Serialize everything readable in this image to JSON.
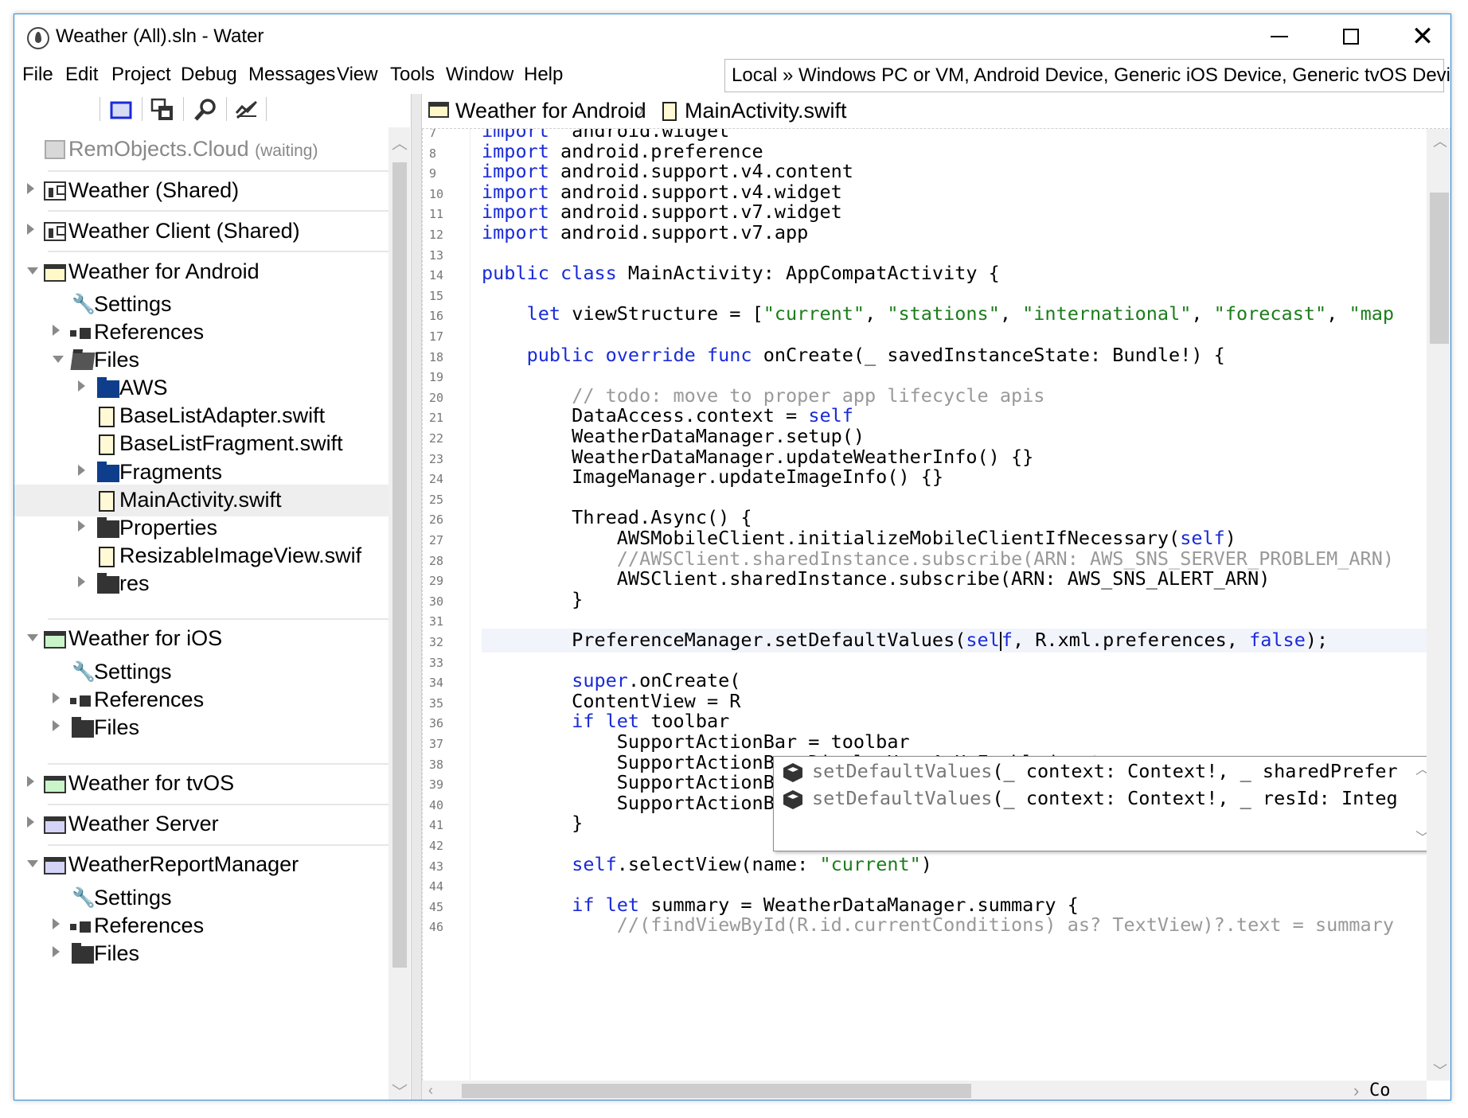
{
  "window": {
    "title": "Weather (All).sln - Water"
  },
  "menu": [
    "File",
    "Edit",
    "Project",
    "Debug",
    "Messages",
    "View",
    "Tools",
    "Window",
    "Help"
  ],
  "target": "Local » Windows PC or VM, Android Device, Generic iOS Device, Generic tvOS Device",
  "toolbar": {
    "icons": [
      "solution-view-icon",
      "split-view-icon",
      "find-icon",
      "compare-icon"
    ]
  },
  "sidebar": {
    "cloud": {
      "label": "RemObjects.Cloud",
      "status": "(waiting)"
    },
    "items": [
      {
        "label": "Weather (Shared)"
      },
      {
        "label": "Weather Client (Shared)"
      },
      {
        "label": "Weather for Android"
      },
      {
        "label": "Settings"
      },
      {
        "label": "References"
      },
      {
        "label": "Files"
      },
      {
        "label": "AWS"
      },
      {
        "label": "BaseListAdapter.swift"
      },
      {
        "label": "BaseListFragment.swift"
      },
      {
        "label": "Fragments"
      },
      {
        "label": "MainActivity.swift"
      },
      {
        "label": "Properties"
      },
      {
        "label": "ResizableImageView.swif"
      },
      {
        "label": "res"
      },
      {
        "label": "Weather for iOS"
      },
      {
        "label": "Settings"
      },
      {
        "label": "References"
      },
      {
        "label": "Files"
      },
      {
        "label": "Weather for tvOS"
      },
      {
        "label": "Weather Server"
      },
      {
        "label": "WeatherReportManager"
      },
      {
        "label": "Settings"
      },
      {
        "label": "References"
      },
      {
        "label": "Files"
      }
    ]
  },
  "breadcrumb": {
    "project": "Weather for Android",
    "file": "MainActivity.swift"
  },
  "editor": {
    "lines": [
      {
        "n": "7",
        "parts": [
          [
            "kw",
            "import"
          ],
          [
            "",
            "  android.widget"
          ]
        ]
      },
      {
        "n": "8",
        "parts": [
          [
            "kw",
            "import"
          ],
          [
            "",
            " android.preference"
          ]
        ]
      },
      {
        "n": "9",
        "parts": [
          [
            "kw",
            "import"
          ],
          [
            "",
            " android.support.v4.content"
          ]
        ]
      },
      {
        "n": "10",
        "parts": [
          [
            "kw",
            "import"
          ],
          [
            "",
            " android.support.v4.widget"
          ]
        ]
      },
      {
        "n": "11",
        "parts": [
          [
            "kw",
            "import"
          ],
          [
            "",
            " android.support.v7.widget"
          ]
        ]
      },
      {
        "n": "12",
        "parts": [
          [
            "kw",
            "import"
          ],
          [
            "",
            " android.support.v7.app"
          ]
        ]
      },
      {
        "n": "13",
        "parts": []
      },
      {
        "n": "14",
        "parts": [
          [
            "kw",
            "public class"
          ],
          [
            "",
            " MainActivity: AppCompatActivity {"
          ]
        ]
      },
      {
        "n": "15",
        "parts": []
      },
      {
        "n": "16",
        "parts": [
          [
            "",
            "    "
          ],
          [
            "kw",
            "let"
          ],
          [
            "",
            " viewStructure = ["
          ],
          [
            "str",
            "\"current\""
          ],
          [
            "",
            ", "
          ],
          [
            "str",
            "\"stations\""
          ],
          [
            "",
            ", "
          ],
          [
            "str",
            "\"international\""
          ],
          [
            "",
            ", "
          ],
          [
            "str",
            "\"forecast\""
          ],
          [
            "",
            ", "
          ],
          [
            "str",
            "\"map"
          ]
        ]
      },
      {
        "n": "17",
        "parts": []
      },
      {
        "n": "18",
        "parts": [
          [
            "",
            "    "
          ],
          [
            "kw",
            "public override func"
          ],
          [
            "",
            " onCreate(_ savedInstanceState: Bundle!) {"
          ]
        ]
      },
      {
        "n": "19",
        "parts": []
      },
      {
        "n": "20",
        "parts": [
          [
            "",
            "        "
          ],
          [
            "cmt",
            "// todo: move to proper app lifecycle apis"
          ]
        ]
      },
      {
        "n": "21",
        "parts": [
          [
            "",
            "        DataAccess.context = "
          ],
          [
            "kw",
            "self"
          ]
        ]
      },
      {
        "n": "22",
        "parts": [
          [
            "",
            "        WeatherDataManager.setup()"
          ]
        ]
      },
      {
        "n": "23",
        "parts": [
          [
            "",
            "        WeatherDataManager.updateWeatherInfo() {}"
          ]
        ]
      },
      {
        "n": "24",
        "parts": [
          [
            "",
            "        ImageManager.updateImageInfo() {}"
          ]
        ]
      },
      {
        "n": "25",
        "parts": []
      },
      {
        "n": "26",
        "parts": [
          [
            "",
            "        Thread.Async() {"
          ]
        ]
      },
      {
        "n": "27",
        "parts": [
          [
            "",
            "            AWSMobileClient.initializeMobileClientIfNecessary("
          ],
          [
            "kw",
            "self"
          ],
          [
            "",
            ")"
          ]
        ]
      },
      {
        "n": "28",
        "parts": [
          [
            "",
            "            "
          ],
          [
            "cmt",
            "//AWSClient.sharedInstance.subscribe(ARN: AWS_SNS_SERVER_PROBLEM_ARN)"
          ]
        ]
      },
      {
        "n": "29",
        "parts": [
          [
            "",
            "            AWSClient.sharedInstance.subscribe(ARN: AWS_SNS_ALERT_ARN)"
          ]
        ]
      },
      {
        "n": "30",
        "parts": [
          [
            "",
            "        }"
          ]
        ]
      },
      {
        "n": "31",
        "parts": []
      },
      {
        "n": "32",
        "parts": [
          [
            "",
            "        PreferenceManager.setDefaultValues("
          ],
          [
            "kw",
            "sel"
          ],
          [
            "caret",
            ""
          ],
          [
            "kw",
            "f"
          ],
          [
            "",
            ", R.xml.preferences, "
          ],
          [
            "kw",
            "false"
          ],
          [
            "",
            ");"
          ]
        ]
      },
      {
        "n": "33",
        "parts": []
      },
      {
        "n": "34",
        "parts": [
          [
            "",
            "        "
          ],
          [
            "kw",
            "super"
          ],
          [
            "",
            ".onCreate("
          ]
        ]
      },
      {
        "n": "35",
        "parts": [
          [
            "",
            "        ContentView = R"
          ]
        ]
      },
      {
        "n": "36",
        "parts": [
          [
            "",
            "        "
          ],
          [
            "kw",
            "if let"
          ],
          [
            "",
            " toolbar"
          ]
        ]
      },
      {
        "n": "37",
        "parts": [
          [
            "",
            "            SupportActionBar = toolbar"
          ]
        ]
      },
      {
        "n": "38",
        "parts": [
          [
            "",
            "            SupportActionBar.DisplayHomeAsUpEnabled = "
          ],
          [
            "kw",
            "true"
          ]
        ]
      },
      {
        "n": "39",
        "parts": [
          [
            "",
            "            SupportActionBar.HomeButtonEnabled = "
          ],
          [
            "kw",
            "true"
          ]
        ]
      },
      {
        "n": "40",
        "parts": [
          [
            "",
            "            SupportActionBar.setHomeAsUpIndicator(R.drawable.ic_drawer)"
          ]
        ]
      },
      {
        "n": "41",
        "parts": [
          [
            "",
            "        }"
          ]
        ]
      },
      {
        "n": "42",
        "parts": []
      },
      {
        "n": "43",
        "parts": [
          [
            "",
            "        "
          ],
          [
            "kw",
            "self"
          ],
          [
            "",
            ".selectView(name: "
          ],
          [
            "str",
            "\"current\""
          ],
          [
            "",
            ")"
          ]
        ]
      },
      {
        "n": "44",
        "parts": []
      },
      {
        "n": "45",
        "parts": [
          [
            "",
            "        "
          ],
          [
            "kw",
            "if let"
          ],
          [
            "",
            " summary = WeatherDataManager.summary {"
          ]
        ]
      },
      {
        "n": "46",
        "parts": [
          [
            "",
            "            "
          ],
          [
            "cmt",
            "//(findViewById(R.id.currentConditions) as? TextView)?.text = summary"
          ]
        ]
      }
    ]
  },
  "completion": {
    "items": [
      {
        "name": "setDefaultValues",
        "sig": "(_ context: Context!, _ sharedPrefer"
      },
      {
        "name": "setDefaultValues",
        "sig": "(_ context: Context!, _ resId: Integ"
      }
    ]
  },
  "hscroll_right_text": "Co"
}
